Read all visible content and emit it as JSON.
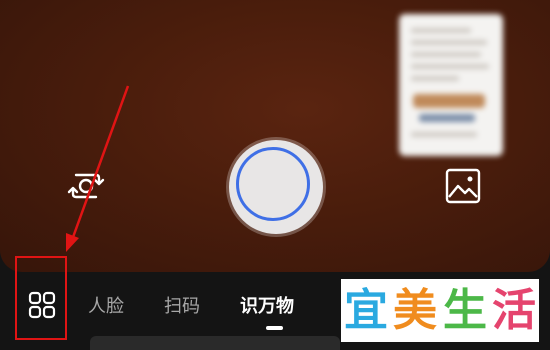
{
  "modes": {
    "items": [
      {
        "label": "人脸"
      },
      {
        "label": "扫码"
      },
      {
        "label": "识万物"
      }
    ],
    "active_index": 2
  },
  "icons": {
    "flip": "flip-camera-icon",
    "gallery": "gallery-icon",
    "grid": "grid-icon",
    "shutter": "shutter-icon"
  },
  "watermark": {
    "chars": [
      "宜",
      "美",
      "生",
      "活"
    ],
    "colors": [
      "#2aa9e0",
      "#f08c1e",
      "#4cb848",
      "#e5446e"
    ]
  },
  "colors": {
    "accent_ring": "#3f6fe6",
    "highlight": "#e01414",
    "camera_bg": "#4a1d0c"
  }
}
